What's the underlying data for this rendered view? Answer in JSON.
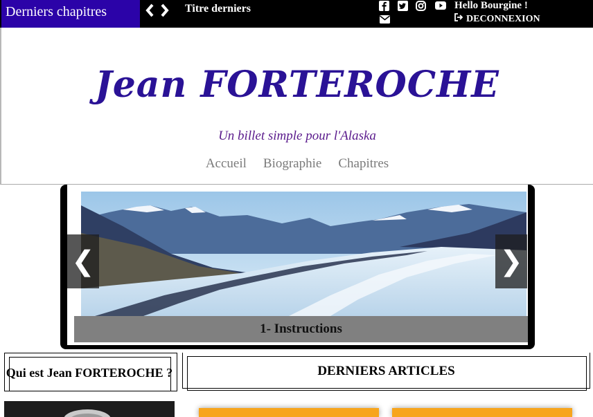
{
  "topbar": {
    "tag_label": "Derniers chapitres",
    "ticker_text": "Titre derniers",
    "greeting": "Hello Bourgine !",
    "logout_label": "DECONNEXION",
    "icons": [
      "chevron-left-icon",
      "chevron-right-icon",
      "facebook-icon",
      "twitter-icon",
      "instagram-icon",
      "youtube-icon",
      "mail-icon",
      "sign-out-icon"
    ]
  },
  "header": {
    "brand": "Jean FORTEROCHE",
    "tagline": "Un billet simple pour l'Alaska",
    "menu": [
      {
        "label": "Accueil"
      },
      {
        "label": "Biographie"
      },
      {
        "label": "Chapitres"
      }
    ]
  },
  "slider": {
    "caption": "1- Instructions",
    "prev_label": "❮",
    "next_label": "❯"
  },
  "sections": {
    "about_title": "Qui est Jean FORTEROCHE ?",
    "articles_title": "DERNIERS ARTICLES"
  },
  "colors": {
    "topbar_tag": "#2b03a8",
    "brand": "#2a1296",
    "tagline": "#5a1a8c",
    "card": "#f7a51d"
  }
}
